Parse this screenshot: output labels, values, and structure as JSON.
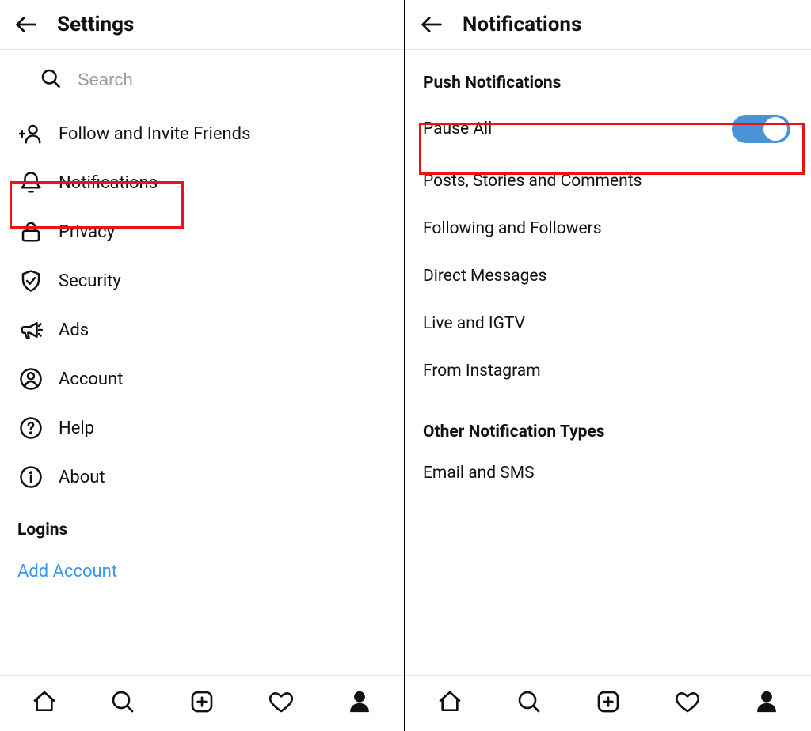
{
  "left": {
    "header": {
      "title": "Settings"
    },
    "search": {
      "placeholder": "Search"
    },
    "items": [
      {
        "label": "Follow and Invite Friends"
      },
      {
        "label": "Notifications"
      },
      {
        "label": "Privacy"
      },
      {
        "label": "Security"
      },
      {
        "label": "Ads"
      },
      {
        "label": "Account"
      },
      {
        "label": "Help"
      },
      {
        "label": "About"
      }
    ],
    "section": "Logins",
    "add_link": "Add Account"
  },
  "right": {
    "header": {
      "title": "Notifications"
    },
    "push_heading": "Push Notifications",
    "pause_label": "Pause All",
    "pause_on": true,
    "items": [
      {
        "label": "Posts, Stories and Comments"
      },
      {
        "label": "Following and Followers"
      },
      {
        "label": "Direct Messages"
      },
      {
        "label": "Live and IGTV"
      },
      {
        "label": "From Instagram"
      }
    ],
    "other_heading": "Other Notification Types",
    "other_items": [
      {
        "label": "Email and SMS"
      }
    ]
  },
  "colors": {
    "highlight": "#e11",
    "link": "#3897f0",
    "toggle": "#4a94d6"
  }
}
